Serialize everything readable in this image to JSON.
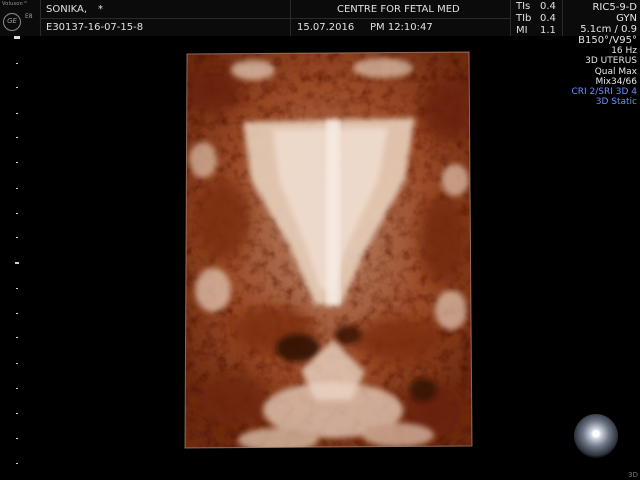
{
  "logo": {
    "brand": "Voluson™",
    "mark": "GE",
    "model": "E8"
  },
  "header": {
    "patient_name": "SONIKA,",
    "patient_marker": "*",
    "institution": "CENTRE FOR FETAL MED",
    "patient_id": "E30137-16-07-15-8",
    "date": "15.07.2016",
    "time": "PM 12:10:47"
  },
  "acoustic": {
    "tis_label": "TIs",
    "tis_value": "0.4",
    "tib_label": "TIb",
    "tib_value": "0.4",
    "mi_label": "MI",
    "mi_value": "1.1"
  },
  "params": {
    "probe": "RIC5-9-D",
    "preset": "GYN",
    "depth_zoom": "5.1cm / 0.9",
    "volume_angle": "B150°/V95°",
    "frame_rate": "16 Hz",
    "mode_title": "3D UTERUS",
    "quality": "Qual Max",
    "mix": "Mix34/66",
    "cri_sri": "CRI 2/SRI 3D 4",
    "static_mode": "3D Static"
  },
  "corner_mark": "3D",
  "colors": {
    "header_bg": "#0b0b0b",
    "blue_param": "#6d8fff",
    "tissue_dark": "#7a2a0e",
    "tissue_light": "#e9d2c0"
  },
  "icons": {
    "logo": "ge-logo-icon",
    "trackball": "trackball-icon"
  }
}
